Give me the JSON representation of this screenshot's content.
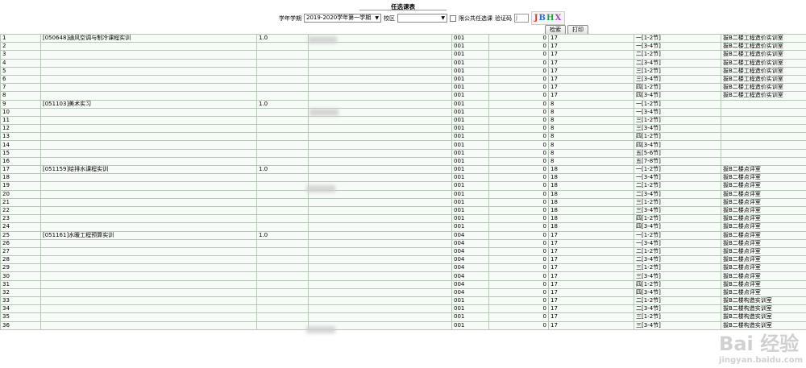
{
  "page": {
    "title": "任选课表"
  },
  "filter": {
    "year_label": "学年学期",
    "year_value": "2019-2020学年第一学期",
    "campus_label": "校区",
    "campus_value": "",
    "public_only_label": "限公共任选课",
    "captcha_label": "验证码",
    "captcha_value": "j",
    "captcha_chars": [
      "J",
      "B",
      "H",
      "X"
    ],
    "search_button": "检索",
    "print_button": "打印"
  },
  "rows": [
    {
      "idx": "1",
      "course": "[050648]通风空调与制冷课程实训",
      "credit": "1.0",
      "teacher": "",
      "c4": "",
      "cls": "001",
      "n": "0",
      "week": "17",
      "time": "一[1-2节]",
      "room": "拔B二楼工程造价实训室"
    },
    {
      "idx": "2",
      "course": "",
      "credit": "",
      "teacher": "",
      "c4": "",
      "cls": "001",
      "n": "0",
      "week": "17",
      "time": "一[3-4节]",
      "room": "拔B二楼工程造价实训室"
    },
    {
      "idx": "3",
      "course": "",
      "credit": "",
      "teacher": "",
      "c4": "",
      "cls": "001",
      "n": "0",
      "week": "17",
      "time": "二[1-2节]",
      "room": "拔B二楼工程造价实训室"
    },
    {
      "idx": "4",
      "course": "",
      "credit": "",
      "teacher": "",
      "c4": "",
      "cls": "001",
      "n": "0",
      "week": "17",
      "time": "二[3-4节]",
      "room": "拔B二楼工程造价实训室"
    },
    {
      "idx": "5",
      "course": "",
      "credit": "",
      "teacher": "",
      "c4": "",
      "cls": "001",
      "n": "0",
      "week": "17",
      "time": "三[1-2节]",
      "room": "拔B二楼工程造价实训室"
    },
    {
      "idx": "6",
      "course": "",
      "credit": "",
      "teacher": "",
      "c4": "",
      "cls": "001",
      "n": "0",
      "week": "17",
      "time": "三[3-4节]",
      "room": "拔B二楼工程造价实训室"
    },
    {
      "idx": "7",
      "course": "",
      "credit": "",
      "teacher": "",
      "c4": "",
      "cls": "001",
      "n": "0",
      "week": "17",
      "time": "四[1-2节]",
      "room": "拔B二楼工程造价实训室"
    },
    {
      "idx": "8",
      "course": "",
      "credit": "",
      "teacher": "",
      "c4": "",
      "cls": "001",
      "n": "0",
      "week": "17",
      "time": "四[3-4节]",
      "room": "拔B二楼工程造价实训室"
    },
    {
      "idx": "9",
      "course": "[051103]美术实习",
      "credit": "1.0",
      "teacher": "",
      "c4": "",
      "cls": "001",
      "n": "0",
      "week": "8",
      "time": "一[1-2节]",
      "room": ""
    },
    {
      "idx": "10",
      "course": "",
      "credit": "",
      "teacher": "",
      "c4": "",
      "cls": "001",
      "n": "0",
      "week": "8",
      "time": "一[3-4节]",
      "room": ""
    },
    {
      "idx": "11",
      "course": "",
      "credit": "",
      "teacher": "",
      "c4": "",
      "cls": "001",
      "n": "0",
      "week": "8",
      "time": "三[1-2节]",
      "room": ""
    },
    {
      "idx": "12",
      "course": "",
      "credit": "",
      "teacher": "",
      "c4": "",
      "cls": "001",
      "n": "0",
      "week": "8",
      "time": "三[3-4节]",
      "room": ""
    },
    {
      "idx": "13",
      "course": "",
      "credit": "",
      "teacher": "",
      "c4": "",
      "cls": "001",
      "n": "0",
      "week": "8",
      "time": "四[1-2节]",
      "room": ""
    },
    {
      "idx": "14",
      "course": "",
      "credit": "",
      "teacher": "",
      "c4": "",
      "cls": "001",
      "n": "0",
      "week": "8",
      "time": "四[3-4节]",
      "room": ""
    },
    {
      "idx": "15",
      "course": "",
      "credit": "",
      "teacher": "",
      "c4": "",
      "cls": "001",
      "n": "0",
      "week": "8",
      "time": "五[5-6节]",
      "room": ""
    },
    {
      "idx": "16",
      "course": "",
      "credit": "",
      "teacher": "",
      "c4": "",
      "cls": "001",
      "n": "0",
      "week": "8",
      "time": "五[7-8节]",
      "room": ""
    },
    {
      "idx": "17",
      "course": "[051159]给排水课程实训",
      "credit": "1.0",
      "teacher": "",
      "c4": "",
      "cls": "001",
      "n": "0",
      "week": "18",
      "time": "一[1-2节]",
      "room": "拔B二楼点评室"
    },
    {
      "idx": "18",
      "course": "",
      "credit": "",
      "teacher": "",
      "c4": "",
      "cls": "001",
      "n": "0",
      "week": "18",
      "time": "一[3-4节]",
      "room": "拔B二楼点评室"
    },
    {
      "idx": "19",
      "course": "",
      "credit": "",
      "teacher": "",
      "c4": "",
      "cls": "001",
      "n": "0",
      "week": "18",
      "time": "二[1-2节]",
      "room": "拔B二楼点评室"
    },
    {
      "idx": "20",
      "course": "",
      "credit": "",
      "teacher": "",
      "c4": "",
      "cls": "001",
      "n": "0",
      "week": "18",
      "time": "二[3-4节]",
      "room": "拔B二楼点评室"
    },
    {
      "idx": "21",
      "course": "",
      "credit": "",
      "teacher": "",
      "c4": "",
      "cls": "001",
      "n": "0",
      "week": "18",
      "time": "三[1-2节]",
      "room": "拔B二楼点评室"
    },
    {
      "idx": "22",
      "course": "",
      "credit": "",
      "teacher": "",
      "c4": "",
      "cls": "001",
      "n": "0",
      "week": "18",
      "time": "三[3-4节]",
      "room": "拔B二楼点评室"
    },
    {
      "idx": "23",
      "course": "",
      "credit": "",
      "teacher": "",
      "c4": "",
      "cls": "001",
      "n": "0",
      "week": "18",
      "time": "四[1-2节]",
      "room": "拔B二楼点评室"
    },
    {
      "idx": "24",
      "course": "",
      "credit": "",
      "teacher": "",
      "c4": "",
      "cls": "001",
      "n": "0",
      "week": "18",
      "time": "四[3-4节]",
      "room": "拔B二楼点评室"
    },
    {
      "idx": "25",
      "course": "[051161]水暖工程预算实训",
      "credit": "1.0",
      "teacher": "",
      "c4": "",
      "cls": "004",
      "n": "0",
      "week": "17",
      "time": "一[1-2节]",
      "room": "拔B二楼点评室"
    },
    {
      "idx": "26",
      "course": "",
      "credit": "",
      "teacher": "",
      "c4": "",
      "cls": "004",
      "n": "0",
      "week": "17",
      "time": "一[3-4节]",
      "room": "拔B二楼点评室"
    },
    {
      "idx": "27",
      "course": "",
      "credit": "",
      "teacher": "",
      "c4": "",
      "cls": "004",
      "n": "0",
      "week": "17",
      "time": "二[1-2节]",
      "room": "拔B二楼点评室"
    },
    {
      "idx": "28",
      "course": "",
      "credit": "",
      "teacher": "",
      "c4": "",
      "cls": "004",
      "n": "0",
      "week": "17",
      "time": "二[3-4节]",
      "room": "拔B二楼点评室"
    },
    {
      "idx": "29",
      "course": "",
      "credit": "",
      "teacher": "",
      "c4": "",
      "cls": "004",
      "n": "0",
      "week": "17",
      "time": "三[1-2节]",
      "room": "拔B二楼点评室"
    },
    {
      "idx": "30",
      "course": "",
      "credit": "",
      "teacher": "",
      "c4": "",
      "cls": "004",
      "n": "0",
      "week": "17",
      "time": "三[3-4节]",
      "room": "拔B二楼点评室"
    },
    {
      "idx": "31",
      "course": "",
      "credit": "",
      "teacher": "",
      "c4": "",
      "cls": "004",
      "n": "0",
      "week": "17",
      "time": "四[1-2节]",
      "room": "拔B二楼点评室"
    },
    {
      "idx": "32",
      "course": "",
      "credit": "",
      "teacher": "",
      "c4": "",
      "cls": "004",
      "n": "0",
      "week": "17",
      "time": "四[3-4节]",
      "room": "拔B二楼点评室"
    },
    {
      "idx": "33",
      "course": "",
      "credit": "",
      "teacher": "",
      "c4": "",
      "cls": "001",
      "n": "0",
      "week": "17",
      "time": "二[1-2节]",
      "room": "拔B二楼构造实训室"
    },
    {
      "idx": "34",
      "course": "",
      "credit": "",
      "teacher": "",
      "c4": "",
      "cls": "001",
      "n": "0",
      "week": "17",
      "time": "二[3-4节]",
      "room": "拔B二楼构造实训室"
    },
    {
      "idx": "35",
      "course": "",
      "credit": "",
      "teacher": "",
      "c4": "",
      "cls": "001",
      "n": "0",
      "week": "17",
      "time": "三[1-2节]",
      "room": "拔B二楼构造实训室"
    },
    {
      "idx": "36",
      "course": "",
      "credit": "",
      "teacher": "",
      "c4": "",
      "cls": "001",
      "n": "0",
      "week": "17",
      "time": "三[3-4节]",
      "room": "拔B二楼构造实训室"
    }
  ],
  "watermark": {
    "brand": "Bai 经验",
    "url": "jingyan.baidu.com"
  }
}
